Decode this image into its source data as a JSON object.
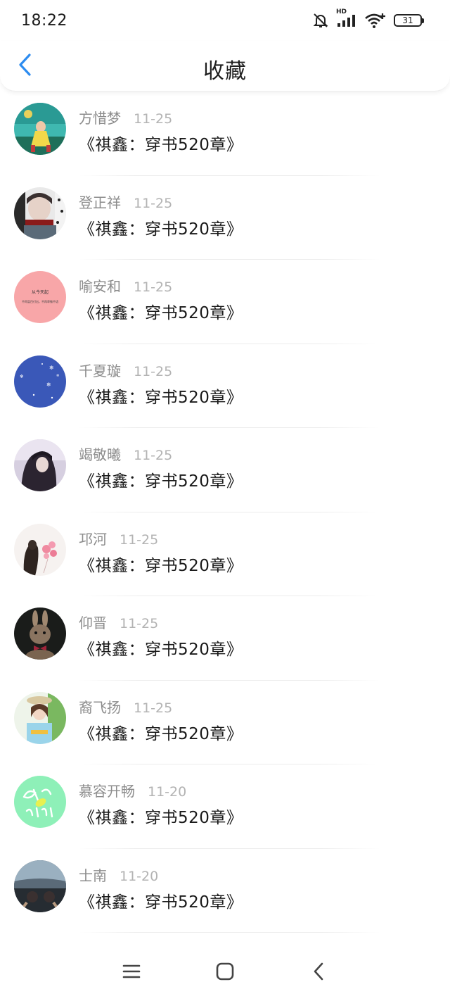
{
  "status_bar": {
    "time": "18:22",
    "battery": "31",
    "network": "HD",
    "icons": [
      "mute-bell-icon",
      "signal-icon",
      "wifi-icon",
      "battery-icon"
    ]
  },
  "header": {
    "title": "收藏",
    "back_icon": "chevron-left-icon",
    "accent_color": "#2d8cf0"
  },
  "favorites": [
    {
      "author": "方惜梦",
      "date": "11-25",
      "title": "《祺鑫：穿书520章》"
    },
    {
      "author": "登正祥",
      "date": "11-25",
      "title": "《祺鑫：穿书520章》"
    },
    {
      "author": "喻安和",
      "date": "11-25",
      "title": "《祺鑫：穿书520章》",
      "avatar_text": [
        "从今天起",
        "不再盲目付出，不再卑微不语"
      ]
    },
    {
      "author": "千夏璇",
      "date": "11-25",
      "title": "《祺鑫：穿书520章》"
    },
    {
      "author": "竭敬曦",
      "date": "11-25",
      "title": "《祺鑫：穿书520章》"
    },
    {
      "author": "邛河",
      "date": "11-25",
      "title": "《祺鑫：穿书520章》"
    },
    {
      "author": "仰晋",
      "date": "11-25",
      "title": "《祺鑫：穿书520章》"
    },
    {
      "author": "裔飞扬",
      "date": "11-25",
      "title": "《祺鑫：穿书520章》"
    },
    {
      "author": "慕容开畅",
      "date": "11-20",
      "title": "《祺鑫：穿书520章》"
    },
    {
      "author": "士南",
      "date": "11-20",
      "title": "《祺鑫：穿书520章》"
    }
  ],
  "nav_bar": {
    "icons": [
      "menu-icon",
      "home-icon",
      "back-icon"
    ]
  }
}
